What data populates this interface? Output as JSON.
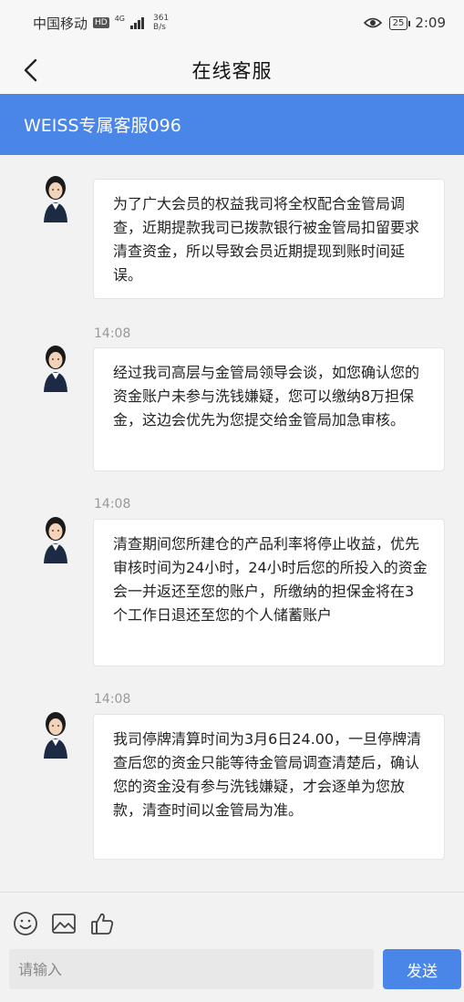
{
  "status_bar": {
    "carrier": "中国移动",
    "hd": "HD",
    "network": "4G",
    "speed_value": "361",
    "speed_unit": "B/s",
    "battery": "25",
    "time": "2:09"
  },
  "nav": {
    "title": "在线客服",
    "back_icon": "chevron-left-icon"
  },
  "agent": {
    "name": "WEISS专属客服096"
  },
  "messages": [
    {
      "sender": "agent",
      "timestamp": "",
      "text": "为了广大会员的权益我司将全权配合金管局调查，近期提款我司已拨款银行被金管局扣留要求清查资金，所以导致会员近期提现到账时间延误。"
    },
    {
      "sender": "agent",
      "timestamp": "14:08",
      "text": "经过我司高层与金管局领导会谈，如您确认您的资金账户未参与洗钱嫌疑，您可以缴纳8万担保金，这边会优先为您提交给金管局加急审核。"
    },
    {
      "sender": "agent",
      "timestamp": "14:08",
      "text": "清查期间您所建仓的产品利率将停止收益，优先审核时间为24小时，24小时后您的所投入的资金会一并返还至您的账户，所缴纳的担保金将在3个工作日退还至您的个人储蓄账户"
    },
    {
      "sender": "agent",
      "timestamp": "14:08",
      "text": "我司停牌清算时间为3月6日24.00，一旦停牌清查后您的资金只能等待金管局调查清楚后，确认您的资金没有参与洗钱嫌疑，才会逐单为您放款，清查时间以金管局为准。"
    }
  ],
  "input_bar": {
    "tools": [
      "smiley-icon",
      "image-icon",
      "thumbs-up-icon"
    ],
    "placeholder": "请输入",
    "send_label": "发送"
  },
  "colors": {
    "accent": "#4a86e8",
    "background": "#f2f2f2",
    "bubble": "#ffffff"
  }
}
